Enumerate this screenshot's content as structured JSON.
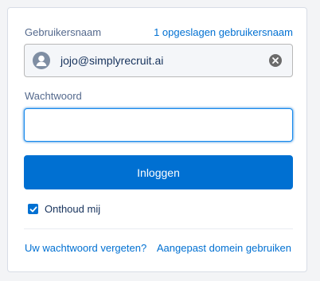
{
  "username": {
    "label": "Gebruikersnaam",
    "saved_link": "1 opgeslagen gebruikersnaam",
    "value": "jojo@simplyrecruit.ai"
  },
  "password": {
    "label": "Wachtwoord",
    "value": ""
  },
  "login_button": "Inloggen",
  "remember": {
    "label": "Onthoud mij",
    "checked": true
  },
  "footer": {
    "forgot_link": "Uw wachtwoord vergeten?",
    "custom_domain_link": "Aangepast domein gebruiken"
  },
  "colors": {
    "accent": "#0070d2",
    "label_text": "#54698d",
    "body_text": "#16325c"
  }
}
